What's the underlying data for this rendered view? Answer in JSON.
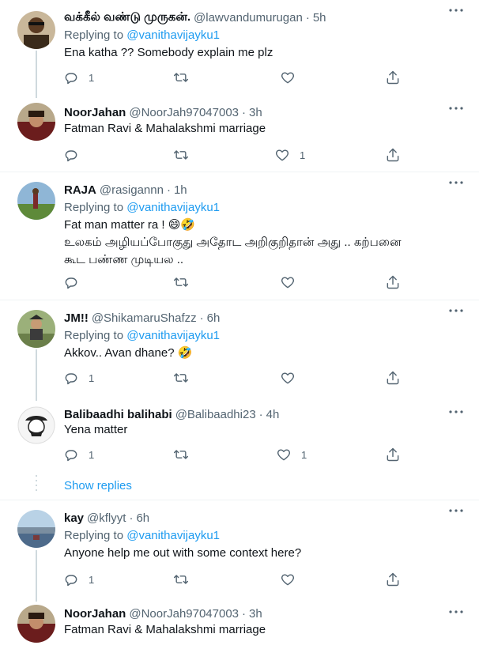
{
  "icons": {
    "reply": "reply-icon",
    "retweet": "retweet-icon",
    "like": "like-icon",
    "share": "share-icon",
    "more": "more-icon"
  },
  "colors": {
    "link": "#1d9bf0",
    "muted": "#536471",
    "text": "#0f1419"
  },
  "tweets": [
    {
      "name": "வக்கீல் வண்டு முருகன்.",
      "handle": "@lawvandumurugan",
      "time": "5h",
      "replying_label": "Replying to",
      "replying_to": "@vanithavijayku1",
      "text": [
        "Ena katha ?? Somebody explain me plz"
      ],
      "reply_count": "1",
      "retweet_count": "",
      "like_count": ""
    },
    {
      "name": "NoorJahan",
      "handle": "@NoorJah97047003",
      "time": "3h",
      "text": [
        "Fatman Ravi & Mahalakshmi marriage"
      ],
      "reply_count": "",
      "retweet_count": "",
      "like_count": "1"
    },
    {
      "name": "RAJA",
      "handle": "@rasigannn",
      "time": "1h",
      "replying_label": "Replying to",
      "replying_to": "@vanithavijayku1",
      "text": [
        "Fat man matter ra ! 😄🤣",
        " உலகம் அழியப்போகுது அதோட அறிகுறிதான் அது .. கற்பனை",
        "கூட பண்ண முடியல .."
      ],
      "reply_count": "",
      "retweet_count": "",
      "like_count": ""
    },
    {
      "name": "JM!!",
      "handle": "@ShikamaruShafzz",
      "time": "6h",
      "replying_label": "Replying to",
      "replying_to": "@vanithavijayku1",
      "text": [
        "Akkov.. Avan dhane? 🤣"
      ],
      "reply_count": "1",
      "retweet_count": "",
      "like_count": ""
    },
    {
      "name": "Balibaadhi balihabi",
      "handle": "@Balibaadhi23",
      "time": "4h",
      "text": [
        "Yena matter"
      ],
      "reply_count": "1",
      "retweet_count": "",
      "like_count": "1"
    },
    {
      "name": "kay",
      "handle": "@kflyyt",
      "time": "6h",
      "replying_label": "Replying to",
      "replying_to": "@vanithavijayku1",
      "text": [
        "Anyone help me out with some context here?"
      ],
      "reply_count": "1",
      "retweet_count": "",
      "like_count": ""
    },
    {
      "name": "NoorJahan",
      "handle": "@NoorJah97047003",
      "time": "3h",
      "text": [
        "Fatman Ravi & Mahalakshmi marriage"
      ]
    }
  ],
  "show_replies": "Show replies"
}
